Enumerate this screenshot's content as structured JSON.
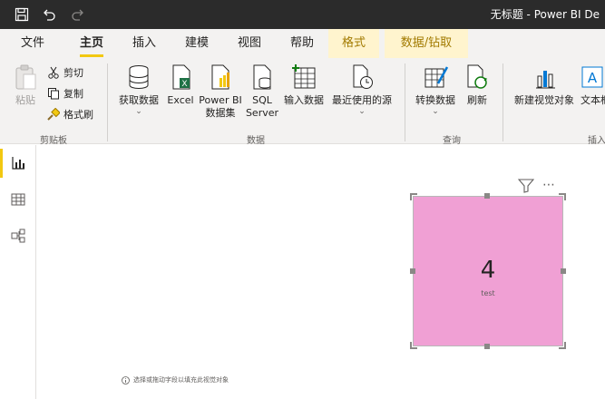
{
  "titlebar": {
    "title": "无标题 - Power BI De"
  },
  "tabs": [
    {
      "label": "文件"
    },
    {
      "label": "主页"
    },
    {
      "label": "插入"
    },
    {
      "label": "建模"
    },
    {
      "label": "视图"
    },
    {
      "label": "帮助"
    },
    {
      "label": "格式"
    },
    {
      "label": "数据/钻取"
    }
  ],
  "ribbon": {
    "paste": "粘贴",
    "cut": "剪切",
    "copy": "复制",
    "format_painter": "格式刷",
    "group_clipboard": "剪贴板",
    "get_data": "获取数据",
    "excel": "Excel",
    "pbi_dataset_line1": "Power BI",
    "pbi_dataset_line2": "数据集",
    "sql_line1": "SQL",
    "sql_line2": "Server",
    "enter_data": "输入数据",
    "recent_sources": "最近使用的源",
    "group_data": "数据",
    "transform_data": "转换数据",
    "refresh": "刷新",
    "group_query": "查询",
    "new_visual": "新建视觉对象",
    "text_box": "文本框",
    "group_insert": "插入"
  },
  "colors": {
    "accent": "#f2c811",
    "card_fill": "#f0a0d4",
    "titlebar": "#2b2b2b"
  },
  "visual": {
    "value": "4",
    "caption": "test"
  },
  "canvas": {
    "hint": "选择或拖动字段以填充此视觉对象"
  }
}
